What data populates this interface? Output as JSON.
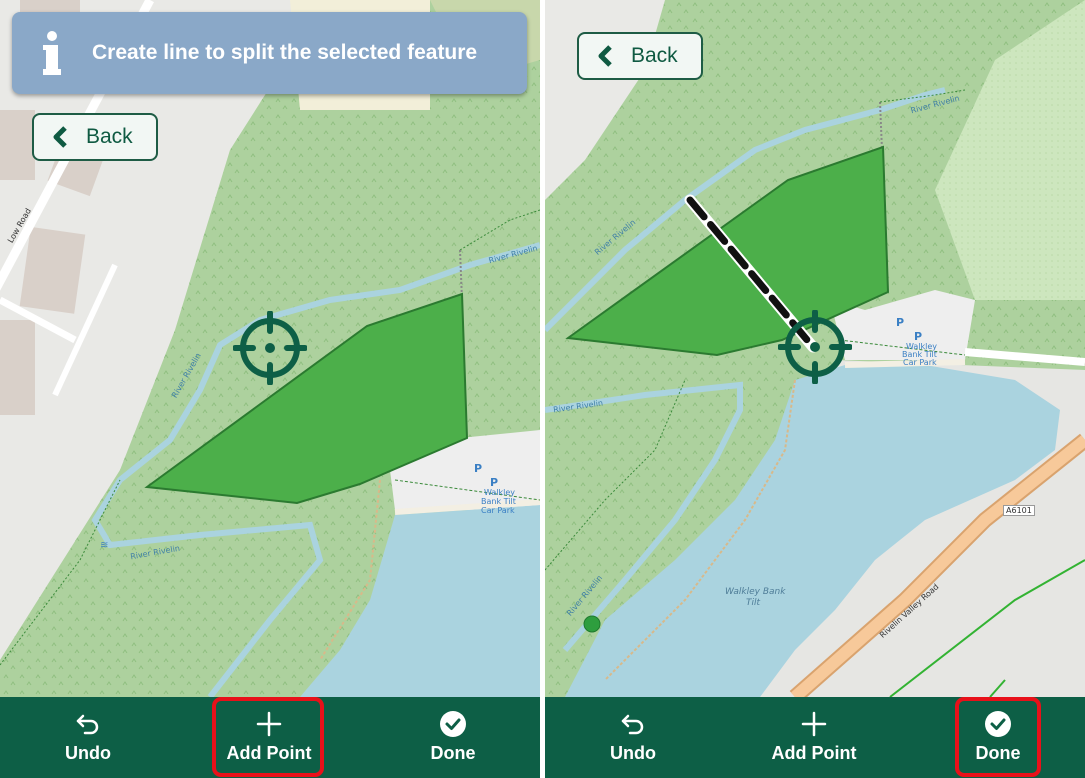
{
  "left": {
    "banner": {
      "icon": "info-icon",
      "text": "Create line to split the selected feature"
    },
    "back_label": "Back",
    "map_labels": {
      "low_road": "Low Road",
      "river_1": "River Rivelin",
      "river_2": "River Rivelin",
      "river_3": "River Rivelin",
      "car_park_line1": "Walkley",
      "car_park_line2": "Bank Tilt",
      "car_park_line3": "Car Park",
      "p1": "P",
      "p2": "P"
    },
    "toolbar": {
      "undo": "Undo",
      "add_point": "Add Point",
      "done": "Done"
    },
    "highlighted": "Add Point"
  },
  "right": {
    "back_label": "Back",
    "map_labels": {
      "river_1": "River Rivelin",
      "river_2": "River Rivelin",
      "river_3": "River Rivelin",
      "river_4": "River Rivelin",
      "car_park_line1": "Walkley",
      "car_park_line2": "Bank Tilt",
      "car_park_line3": "Car Park",
      "p1": "P",
      "p2": "P",
      "lake_line1": "Walkley Bank",
      "lake_line2": "Tilt",
      "road_ref": "A6101",
      "road_name": "Rivelin Valley Road"
    },
    "toolbar": {
      "undo": "Undo",
      "add_point": "Add Point",
      "done": "Done"
    },
    "highlighted": "Done"
  },
  "colors": {
    "toolbar_bg": "#0d5f46",
    "banner_bg": "#8aa8c8",
    "polygon_fill": "#4caf4a",
    "crosshair": "#0d5f46",
    "highlight": "#e8111a",
    "water": "#aad3df",
    "forest": "#add19e"
  }
}
